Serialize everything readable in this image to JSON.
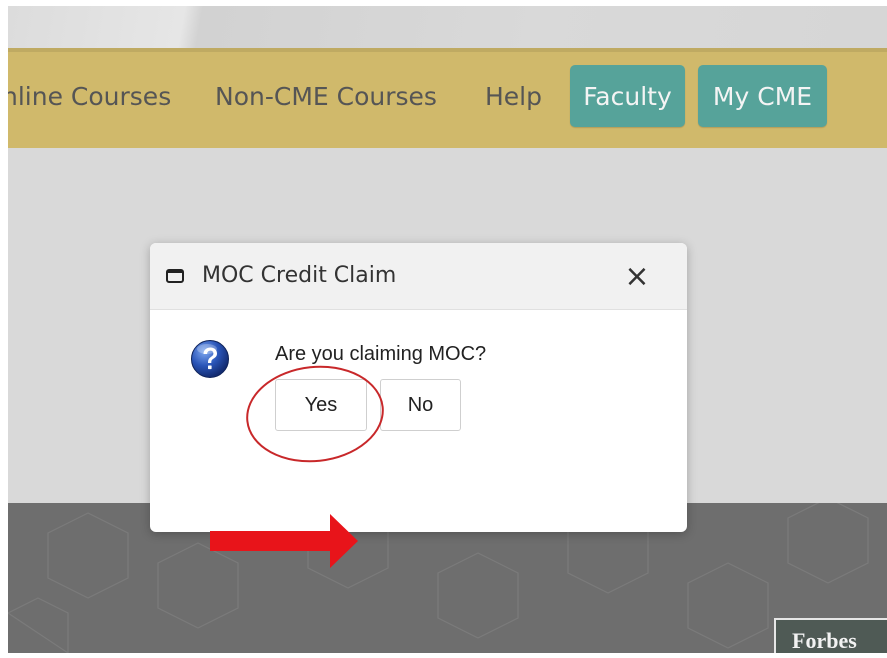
{
  "nav": {
    "links": [
      "nline Courses",
      "Non-CME Courses",
      "Help"
    ],
    "buttons": [
      "Faculty",
      "My CME"
    ]
  },
  "dialog": {
    "title": "MOC Credit Claim",
    "close_glyph": "×",
    "question": "Are you claiming MOC?",
    "yes_label": "Yes",
    "no_label": "No"
  },
  "footer": {
    "badge": "Forbes"
  },
  "colors": {
    "nav_bar": "#d0b96b",
    "nav_button": "#56a39a",
    "annotation_circle": "#c8282a",
    "annotation_arrow": "#e8141a"
  },
  "icons": {
    "dialog_title": "window-icon",
    "question": "question-icon",
    "close": "close-icon"
  }
}
